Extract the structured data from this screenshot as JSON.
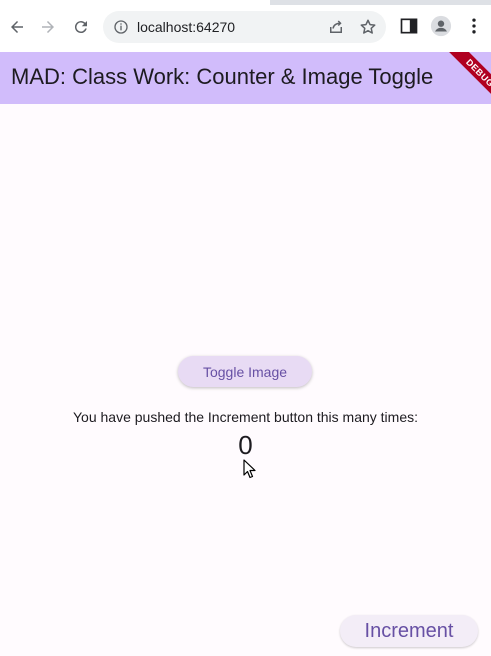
{
  "browser": {
    "url": "localhost:64270"
  },
  "app_bar": {
    "title": "MAD: Class Work: Counter & Image Toggle",
    "debug_label": "DEBUG"
  },
  "main": {
    "toggle_label": "Toggle Image",
    "counter_label": "You have pushed the Increment button this many times:",
    "counter_value": "0",
    "increment_label": "Increment"
  },
  "colors": {
    "app_bar": "#d1bcfb",
    "accent": "#6750a4",
    "background": "#fffbfe"
  }
}
